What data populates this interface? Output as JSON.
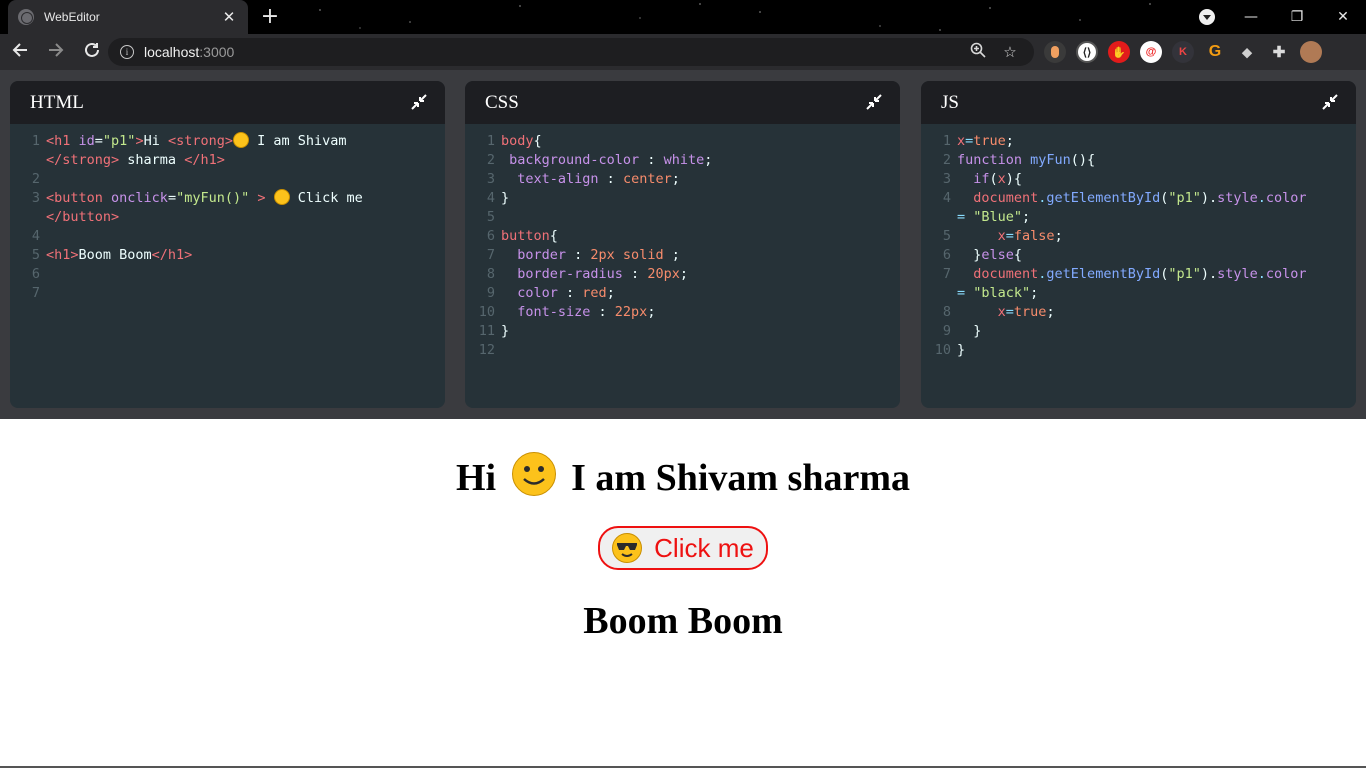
{
  "browser": {
    "tab_title": "WebEditor",
    "url_host": "localhost",
    "url_port": ":3000"
  },
  "panes": {
    "html": {
      "title": "HTML",
      "line_numbers": [
        "1",
        "2",
        "3",
        "4",
        "5",
        "6",
        "7"
      ],
      "lines": [
        [
          "<h1 ",
          "id",
          "=",
          "\"p1\"",
          ">",
          "Hi ",
          "<strong>",
          " I am Shivam"
        ],
        [
          "</strong>",
          " sharma ",
          "</h1>"
        ],
        [
          "<button ",
          "onclick",
          "=",
          "\"myFun()\"",
          " > ",
          " Click me"
        ],
        [
          "</button>"
        ],
        [
          "<h1>",
          "Boom Boom",
          "</h1>"
        ]
      ]
    },
    "css": {
      "title": "CSS",
      "line_numbers": [
        "1",
        "2",
        "3",
        "4",
        "5",
        "6",
        "7",
        "8",
        "9",
        "10",
        "11",
        "12"
      ],
      "lines": [
        [
          "body",
          "{"
        ],
        [
          " background-color",
          " : ",
          "white",
          ";"
        ],
        [
          "  text-align",
          " : ",
          "center",
          ";"
        ],
        [
          "}"
        ],
        [
          "button",
          "{"
        ],
        [
          "  border",
          " : ",
          "2px solid",
          " ;"
        ],
        [
          "  border-radius",
          " : ",
          "20px",
          ";"
        ],
        [
          "  color",
          " : ",
          "red",
          ";"
        ],
        [
          "  font-size",
          " : ",
          "22px",
          ";"
        ],
        [
          "}"
        ]
      ]
    },
    "js": {
      "title": "JS",
      "line_numbers": [
        "1",
        "2",
        "3",
        "4",
        "5",
        "6",
        "7",
        "8",
        "9",
        "10"
      ],
      "lines": [
        [
          "x",
          "=",
          "true",
          ";"
        ],
        [
          "function ",
          "myFun",
          "(){"
        ],
        [
          "  if",
          "(",
          "x",
          "){"
        ],
        [
          "  document",
          ".",
          "getElementById",
          "(",
          "\"p1\"",
          ").",
          "style",
          ".",
          "color"
        ],
        [
          "= ",
          "\"Blue\"",
          ";"
        ],
        [
          "     x",
          "=",
          "false",
          ";"
        ],
        [
          "  }",
          "else",
          "{"
        ],
        [
          "  document",
          ".",
          "getElementById",
          "(",
          "\"p1\"",
          ").",
          "style",
          ".",
          "color"
        ],
        [
          "= ",
          "\"black\"",
          ";"
        ],
        [
          "     x",
          "=",
          "true",
          ";"
        ],
        [
          "  }"
        ],
        [
          "}"
        ]
      ]
    }
  },
  "output": {
    "heading_hi": "Hi",
    "heading_rest": "I am Shivam sharma",
    "button_label": "Click me",
    "heading2": "Boom Boom"
  },
  "colors": {
    "button_red": "#ee1111",
    "editor_bg": "#263238",
    "pane_header_bg": "#1d1e22"
  },
  "icons": [
    "back-arrow-icon",
    "forward-arrow-icon",
    "reload-icon",
    "info-icon",
    "zoom-icon",
    "bookmark-star-icon",
    "extensions-puzzle-icon",
    "collapse-icon",
    "smiley-emoji-icon",
    "sunglasses-emoji-icon"
  ]
}
